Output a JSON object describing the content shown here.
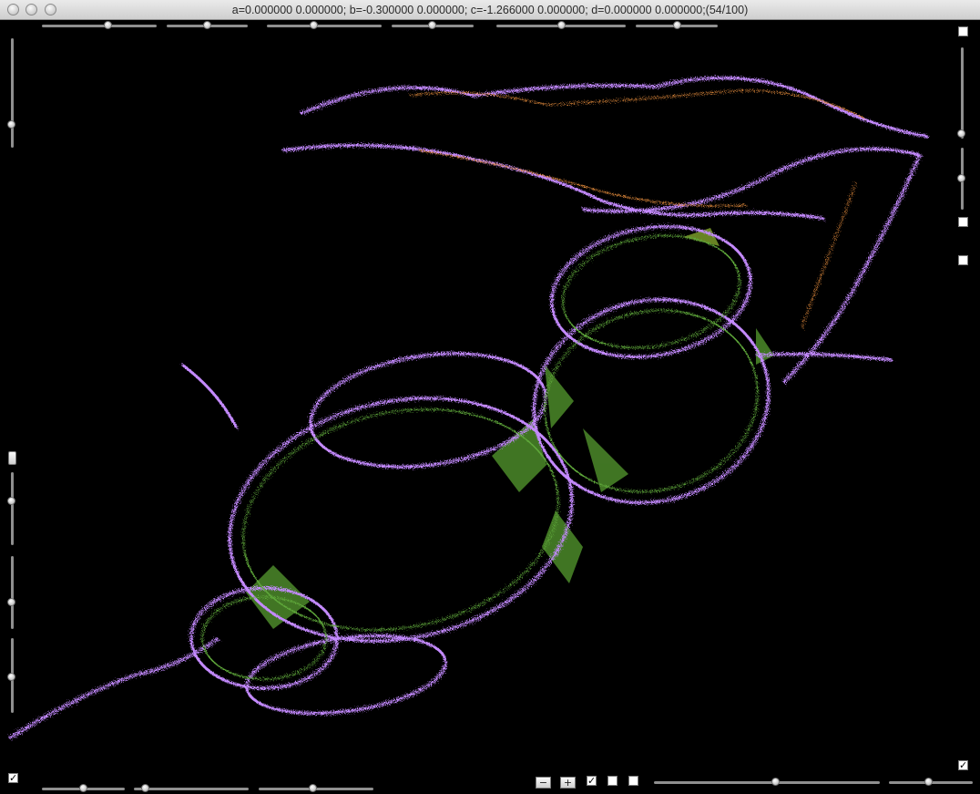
{
  "window": {
    "title": "a=0.000000 0.000000; b=-0.300000 0.000000; c=-1.266000 0.000000; d=0.000000 0.000000;(54/100)"
  },
  "buttons": {
    "minus": "−",
    "plus": "+"
  },
  "checkboxes": {
    "check_glyph": "✓",
    "bottom_left": true,
    "bottom_mid_1": true,
    "bottom_mid_2": false,
    "bottom_mid_3": false,
    "right_top": false,
    "right_mid_1": false,
    "right_mid_2": false,
    "bottom_right": true
  },
  "colors": {
    "background": "#000000",
    "fractal_edge": "#c48aff",
    "fractal_fill": "#4c8a2a",
    "fractal_hot": "#d48238"
  },
  "icons": [
    "window-close-icon",
    "window-minimize-icon",
    "window-zoom-icon"
  ]
}
